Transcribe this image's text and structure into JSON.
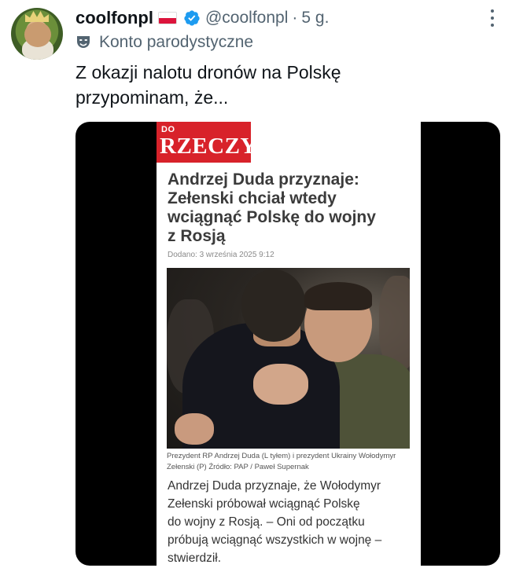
{
  "tweet": {
    "display_name": "coolfonpl",
    "handle": "@coolfonpl",
    "separator": "·",
    "time": "5 g.",
    "parody_label": "Konto parodystyczne",
    "text_line1": "Z okazji nalotu dronów na Polskę",
    "text_line2": "przypominam, że..."
  },
  "article": {
    "logo_top": "DO",
    "logo_main": "RZECZY",
    "headline_line1": "Andrzej Duda przyznaje:",
    "headline_line2": "Zełenski chciał wtedy",
    "headline_line3": "wciągnąć Polskę do wojny",
    "headline_line4": "z Rosją",
    "date": "Dodano: 3 września 2025 9:12",
    "caption_line1": "Prezydent RP Andrzej Duda (L tyłem) i prezydent Ukrainy Wołodymyr",
    "caption_line2": "Zełenski (P) Źródło: PAP / Paweł Supernak",
    "lead_line1": "Andrzej Duda przyznaje, że Wołodymyr",
    "lead_line2": "Zełenski próbował wciągnąć Polskę",
    "lead_line3": "do wojny z Rosją. – Oni od początku",
    "lead_line4": "próbują wciągnąć wszystkich w wojnę –",
    "lead_line5": "stwierdził."
  },
  "icons": {
    "verified": "verified-badge-icon",
    "flag": "poland-flag-icon",
    "parody": "theater-mask-icon",
    "more": "more-options-icon"
  },
  "colors": {
    "verified": "#1d9bf0",
    "secondary_text": "#536471",
    "logo_red": "#d8222a"
  }
}
